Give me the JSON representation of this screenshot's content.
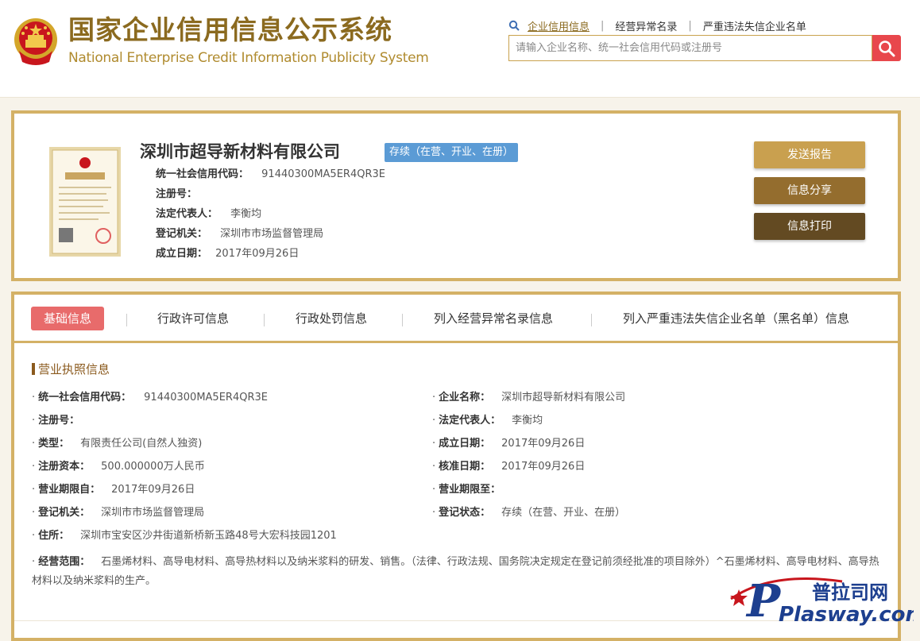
{
  "site": {
    "title_cn": "国家企业信用信息公示系统",
    "title_en": "National Enterprise Credit Information Publicity System",
    "emblem_icon": "national-emblem-icon"
  },
  "topnav": {
    "items": [
      "企业信用信息",
      "经营异常名录",
      "严重违法失信企业名单"
    ],
    "separator": "|"
  },
  "search": {
    "placeholder": "请输入企业名称、统一社会信用代码或注册号",
    "button_icon": "search-icon"
  },
  "company": {
    "name": "深圳市超导新材料有限公司",
    "status": "存续（在营、开业、在册）",
    "fields": [
      {
        "label": "统一社会信用代码：",
        "value": "91440300MA5ER4QR3E"
      },
      {
        "label": "注册号：",
        "value": ""
      },
      {
        "label": "法定代表人：",
        "value": "李衡均"
      },
      {
        "label": "登记机关：",
        "value": "深圳市市场监督管理局"
      },
      {
        "label": "成立日期：",
        "value": "2017年09月26日"
      }
    ],
    "actions": [
      "发送报告",
      "信息分享",
      "信息打印"
    ]
  },
  "tabs": [
    "基础信息",
    "行政许可信息",
    "行政处罚信息",
    "列入经营异常名录信息",
    "列入严重违法失信企业名单（黑名单）信息"
  ],
  "license_section": {
    "title": "营业执照信息",
    "left": [
      {
        "label": "统一社会信用代码：",
        "value": "91440300MA5ER4QR3E"
      },
      {
        "label": "注册号：",
        "value": ""
      },
      {
        "label": "类型：",
        "value": "有限责任公司(自然人独资)"
      },
      {
        "label": "注册资本：",
        "value": "500.000000万人民币"
      },
      {
        "label": "营业期限自：",
        "value": "2017年09月26日"
      },
      {
        "label": "登记机关：",
        "value": "深圳市市场监督管理局"
      },
      {
        "label": "住所：",
        "value": "深圳市宝安区沙井街道新桥新玉路48号大宏科技园1201"
      }
    ],
    "right": [
      {
        "label": "企业名称：",
        "value": "深圳市超导新材料有限公司"
      },
      {
        "label": "法定代表人：",
        "value": "李衡均"
      },
      {
        "label": "成立日期：",
        "value": "2017年09月26日"
      },
      {
        "label": "核准日期：",
        "value": "2017年09月26日"
      },
      {
        "label": "营业期限至：",
        "value": ""
      },
      {
        "label": "登记状态：",
        "value": "存续（在营、开业、在册）"
      }
    ],
    "scope": {
      "label": "经营范围：",
      "value": "石墨烯材料、高导电材料、高导热材料以及纳米浆料的研发、销售。（法律、行政法规、国务院决定规定在登记前须经批准的项目除外）^石墨烯材料、高导电材料、高导热材料以及纳米浆料的生产。"
    }
  },
  "watermark": {
    "top": "普拉司网",
    "bottom": "Plasway.com"
  },
  "colors": {
    "gold": "#d4b166",
    "brown_text": "#8b6a1f",
    "tab_active": "#e86b6b",
    "badge": "#5b9bd5",
    "search_btn": "#e8474c"
  }
}
